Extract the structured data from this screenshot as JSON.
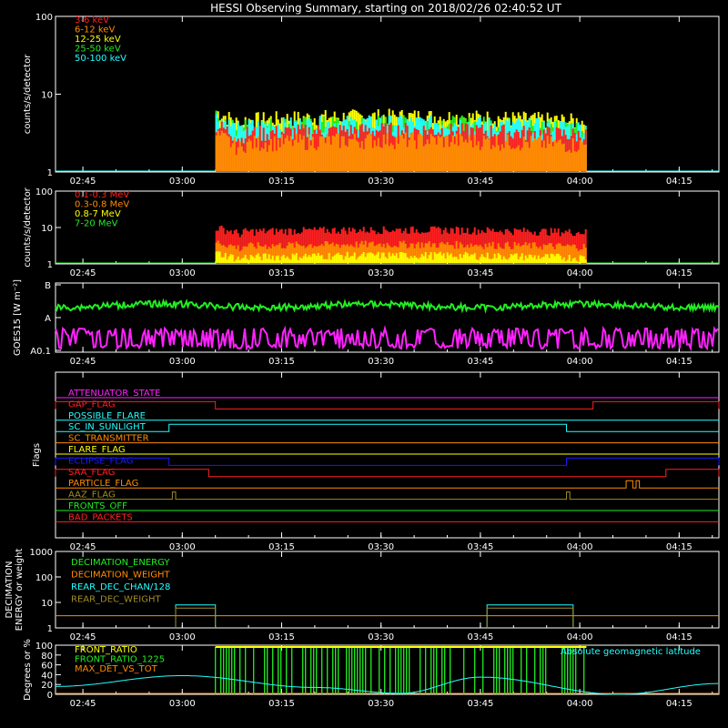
{
  "title": "HESSI Observing Summary, starting on 2018/02/26 02:40:52 UT",
  "time_ticks": [
    "02:45",
    "03:00",
    "03:15",
    "03:30",
    "03:45",
    "04:00",
    "04:15"
  ],
  "colors": {
    "background": "#000000",
    "axes": "#ffffff",
    "red": "#ff2020",
    "orange": "#ff8c00",
    "yellow": "#ffff00",
    "green": "#22ee22",
    "cyan": "#22ffff",
    "magenta": "#ff22ff",
    "blue": "#1a1aff",
    "olive": "#a08c28"
  },
  "chart_data": [
    {
      "id": "lowE",
      "type": "line",
      "scale": "log",
      "ylabel": "counts/s/detector",
      "ylim": [
        1,
        100
      ],
      "y_tick_labels": [
        "1",
        "10",
        "100"
      ],
      "xlim": [
        "02:40:52",
        "04:21:00"
      ],
      "legend_placement": "top-left",
      "observation_window": [
        "03:05",
        "04:01"
      ],
      "series": [
        {
          "name": "3-6 keV",
          "color": "red",
          "level": 4
        },
        {
          "name": "6-12 keV",
          "color": "orange",
          "level": 3
        },
        {
          "name": "12-25 keV",
          "color": "yellow",
          "level": 6
        },
        {
          "name": "25-50 keV",
          "color": "green",
          "level": 5
        },
        {
          "name": "50-100 keV",
          "color": "cyan",
          "level": 5
        }
      ]
    },
    {
      "id": "highE",
      "type": "line",
      "scale": "log",
      "ylabel": "counts/s/detector",
      "ylim": [
        1,
        100
      ],
      "y_tick_labels": [
        "1",
        "10",
        "100"
      ],
      "legend_placement": "top-left",
      "observation_window": [
        "03:05",
        "04:01"
      ],
      "series": [
        {
          "name": "0.1-0.3 MeV",
          "color": "red",
          "level": 10
        },
        {
          "name": "0.3-0.8 MeV",
          "color": "orange",
          "level": 4
        },
        {
          "name": "0.8-7 MeV",
          "color": "yellow",
          "level": 2
        },
        {
          "name": "7-20 MeV",
          "color": "green",
          "level": 1
        }
      ]
    },
    {
      "id": "goes",
      "type": "line",
      "ylabel": "GOES15 [W m⁻²]",
      "y_tick_labels": [
        "A0.1",
        "A",
        "B"
      ],
      "series": [
        {
          "color": "green",
          "class_level": "A5"
        },
        {
          "color": "magenta",
          "class_level": "A0.3"
        }
      ]
    },
    {
      "id": "flags",
      "type": "line",
      "ylabel": "Flags",
      "series": [
        {
          "name": "ATTENUATOR_STATE",
          "color": "magenta",
          "on": []
        },
        {
          "name": "GAP_FLAG",
          "color": "red",
          "on": [
            [
              "02:40:52",
              "03:05"
            ],
            [
              "04:02",
              "04:21"
            ]
          ]
        },
        {
          "name": "POSSIBLE_FLARE",
          "color": "cyan",
          "on": []
        },
        {
          "name": "SC_IN_SUNLIGHT",
          "color": "cyan",
          "on": [
            [
              "02:58",
              "03:58"
            ]
          ]
        },
        {
          "name": "SC_TRANSMITTER",
          "color": "orange",
          "on": []
        },
        {
          "name": "FLARE_FLAG",
          "color": "yellow",
          "on": []
        },
        {
          "name": "ECLIPSE_FLAG",
          "color": "blue",
          "on": [
            [
              "02:40:52",
              "02:58"
            ],
            [
              "03:58",
              "04:21"
            ]
          ]
        },
        {
          "name": "SAA_FLAG",
          "color": "red",
          "on": [
            [
              "02:40:52",
              "03:04"
            ],
            [
              "04:13",
              "04:21"
            ]
          ]
        },
        {
          "name": "PARTICLE_FLAG",
          "color": "orange",
          "on": [
            [
              "04:07",
              "04:08"
            ],
            [
              "04:08:30",
              "04:09"
            ]
          ]
        },
        {
          "name": "AAZ_FLAG",
          "color": "olive",
          "on": [
            [
              "02:58:30",
              "02:59"
            ],
            [
              "03:58",
              "03:58:30"
            ]
          ]
        },
        {
          "name": "FRONTS_OFF",
          "color": "green",
          "on": []
        },
        {
          "name": "BAD_PACKETS",
          "color": "red",
          "on": []
        }
      ]
    },
    {
      "id": "decim",
      "type": "line",
      "scale": "log",
      "ylabel": "DECIMATION ENERGY or weight",
      "ylim": [
        1,
        1000
      ],
      "y_tick_labels": [
        "1",
        "10",
        "100",
        "1000"
      ],
      "series": [
        {
          "name": "DECIMATION_ENERGY",
          "color": "green",
          "value": 0
        },
        {
          "name": "DECIMATION_WEIGHT",
          "color": "orange",
          "value": 3,
          "segments": [
            [
              "02:40:52",
              "02:59"
            ],
            [
              "03:00",
              "03:05"
            ],
            [
              "03:46",
              "03:58"
            ],
            [
              "03:59",
              "04:21"
            ]
          ]
        },
        {
          "name": "REAR_DEC_CHAN/128",
          "color": "cyan",
          "value": 8,
          "segments": [
            [
              "02:59",
              "03:05"
            ],
            [
              "03:46",
              "03:59"
            ]
          ]
        },
        {
          "name": "REAR_DEC_WEIGHT",
          "color": "olive",
          "value": 6,
          "segments": [
            [
              "02:59",
              "03:05"
            ],
            [
              "03:46",
              "03:59"
            ]
          ]
        }
      ]
    },
    {
      "id": "ratio",
      "type": "line",
      "ylabel": "Degrees or %",
      "ylim": [
        0,
        100
      ],
      "y_tick_labels": [
        "0",
        "20",
        "40",
        "60",
        "80",
        "100"
      ],
      "series": [
        {
          "name": "FRONT_RATIO",
          "color": "yellow",
          "value": 100
        },
        {
          "name": "FRONT_RATIO_1225",
          "color": "green",
          "value": 100
        },
        {
          "name": "MAX_DET_VS_TOT",
          "color": "orange",
          "value": 0
        },
        {
          "name": "Absolute geomagnetic latitude",
          "color": "cyan",
          "x": [
            "02:40:52",
            "03:00",
            "03:20",
            "03:33",
            "03:45",
            "04:06",
            "04:21"
          ],
          "y": [
            16,
            38,
            14,
            2,
            35,
            0,
            22
          ]
        }
      ]
    }
  ]
}
